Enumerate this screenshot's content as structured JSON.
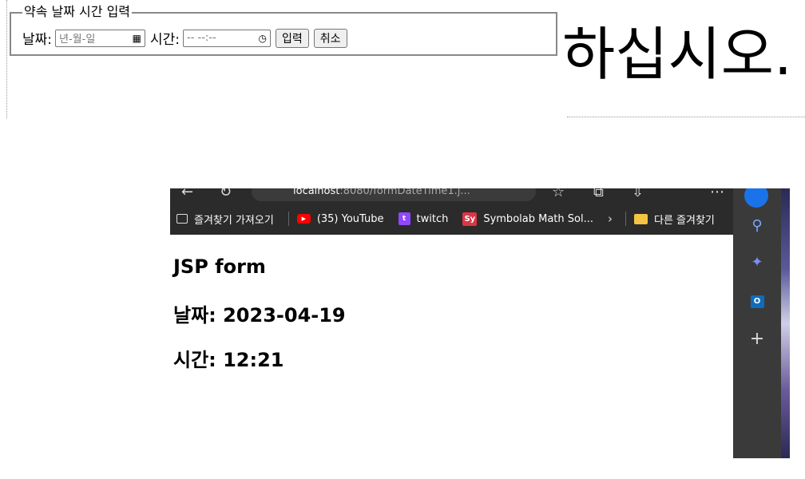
{
  "form": {
    "legend": "약속 날짜 시간 입력",
    "date_label": "날짜:",
    "date_placeholder": "년-월-일",
    "time_label": "시간:",
    "time_placeholder": "-- --:--",
    "submit_label": "입력",
    "reset_label": "취소"
  },
  "background_text": "하십시오.",
  "browser": {
    "url_host": "localhost",
    "url_path": ":8080/formDateTime1.j...",
    "bookmarks": [
      {
        "label": "즐겨찾기 가져오기",
        "icon": "import-icon"
      },
      {
        "label": "(35) YouTube",
        "icon": "youtube-icon"
      },
      {
        "label": "twitch",
        "icon": "twitch-icon"
      },
      {
        "label": "Symbolab Math Sol...",
        "icon": "symbolab-icon"
      }
    ],
    "other_favorites": "다른 즐겨찾기",
    "sidebar_icons": [
      "search-icon",
      "copilot-icon",
      "outlook-icon",
      "plus-icon"
    ]
  },
  "result": {
    "title": "JSP form",
    "date_line": "날짜: 2023-04-19",
    "time_line": "시간: 12:21"
  }
}
